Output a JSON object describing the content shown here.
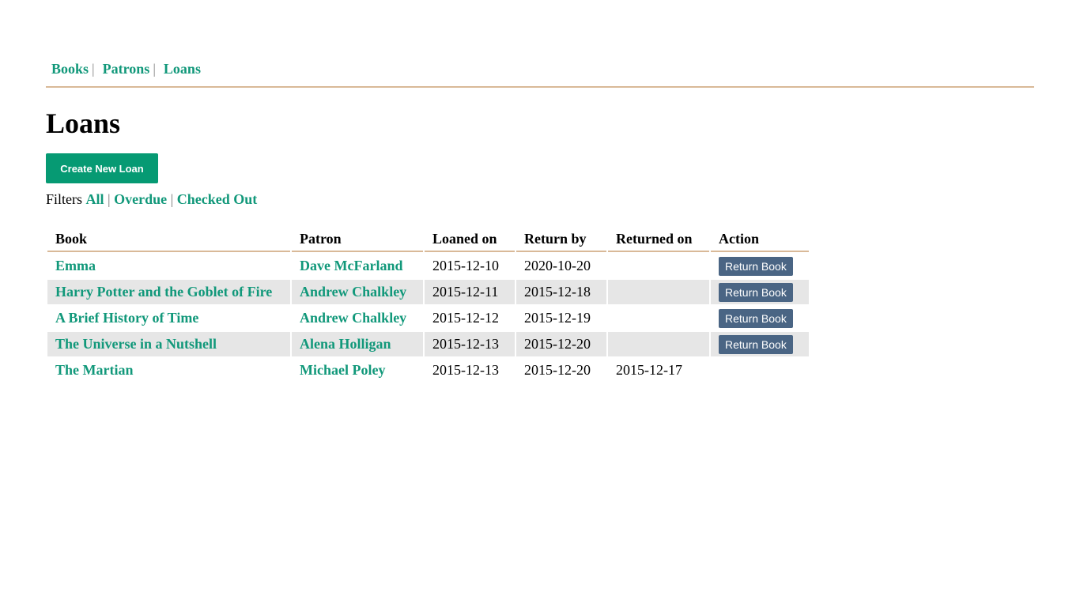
{
  "nav": {
    "items": [
      {
        "label": "Books"
      },
      {
        "label": "Patrons"
      },
      {
        "label": "Loans"
      }
    ],
    "separator": "|"
  },
  "page": {
    "title": "Loans",
    "create_button_label": "Create New Loan"
  },
  "filters": {
    "label": "Filters",
    "separator": "|",
    "options": [
      {
        "label": "All"
      },
      {
        "label": "Overdue"
      },
      {
        "label": "Checked Out"
      }
    ]
  },
  "table": {
    "headers": [
      "Book",
      "Patron",
      "Loaned on",
      "Return by",
      "Returned on",
      "Action"
    ],
    "rows": [
      {
        "book": "Emma",
        "patron": "Dave McFarland",
        "loaned_on": "2015-12-10",
        "return_by": "2020-10-20",
        "returned_on": "",
        "action": "Return Book"
      },
      {
        "book": "Harry Potter and the Goblet of Fire",
        "patron": "Andrew Chalkley",
        "loaned_on": "2015-12-11",
        "return_by": "2015-12-18",
        "returned_on": "",
        "action": "Return Book"
      },
      {
        "book": "A Brief History of Time",
        "patron": "Andrew Chalkley",
        "loaned_on": "2015-12-12",
        "return_by": "2015-12-19",
        "returned_on": "",
        "action": "Return Book"
      },
      {
        "book": "The Universe in a Nutshell",
        "patron": "Alena Holligan",
        "loaned_on": "2015-12-13",
        "return_by": "2015-12-20",
        "returned_on": "",
        "action": "Return Book"
      },
      {
        "book": "The Martian",
        "patron": "Michael Poley",
        "loaned_on": "2015-12-13",
        "return_by": "2015-12-20",
        "returned_on": "2015-12-17",
        "action": ""
      }
    ]
  },
  "colors": {
    "link": "#11987a",
    "primary_button": "#069a73",
    "return_button": "#4a6584",
    "divider": "#d9b998",
    "alt_row": "#e6e6e6"
  }
}
